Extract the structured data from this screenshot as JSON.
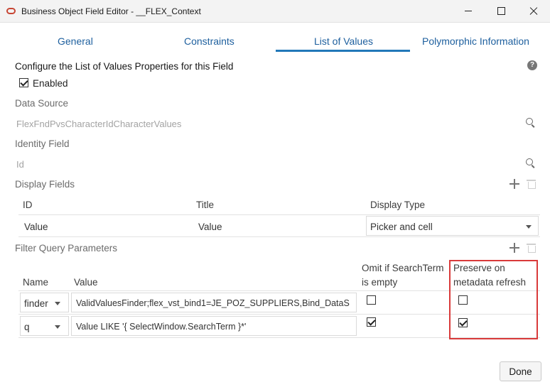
{
  "window": {
    "title": "Business Object Field Editor - __FLEX_Context"
  },
  "tabs": [
    {
      "label": "General"
    },
    {
      "label": "Constraints"
    },
    {
      "label": "List of Values"
    },
    {
      "label": "Polymorphic Information"
    }
  ],
  "active_tab": "List of Values",
  "section_title": "Configure the List of Values Properties for this Field",
  "enabled": {
    "label": "Enabled",
    "checked": true
  },
  "data_source": {
    "label": "Data Source",
    "value": "FlexFndPvsCharacterIdCharacterValues"
  },
  "identity_field": {
    "label": "Identity Field",
    "value": "Id"
  },
  "display_fields": {
    "label": "Display Fields",
    "columns": [
      "ID",
      "Title",
      "Display Type"
    ],
    "rows": [
      {
        "id": "Value",
        "title": "Value",
        "display_type": "Picker and cell"
      }
    ]
  },
  "filter_query": {
    "label": "Filter Query Parameters",
    "columns": {
      "name": "Name",
      "value": "Value",
      "omit": "Omit if SearchTerm is empty",
      "omit_line1": "Omit if SearchTerm",
      "omit_line2": "is empty",
      "preserve_line1": "Preserve on",
      "preserve_line2": "metadata refresh"
    },
    "rows": [
      {
        "name": "finder",
        "value": "ValidValuesFinder;flex_vst_bind1=JE_POZ_SUPPLIERS,Bind_DataS",
        "omit": false,
        "preserve": false
      },
      {
        "name": "q",
        "value": "Value LIKE '{ SelectWindow.SearchTerm }*'",
        "omit": true,
        "preserve": true
      }
    ]
  },
  "done_label": "Done",
  "colors": {
    "accent": "#2278b9",
    "tab_text": "#1d5f9e",
    "highlight": "#d93a3a"
  }
}
